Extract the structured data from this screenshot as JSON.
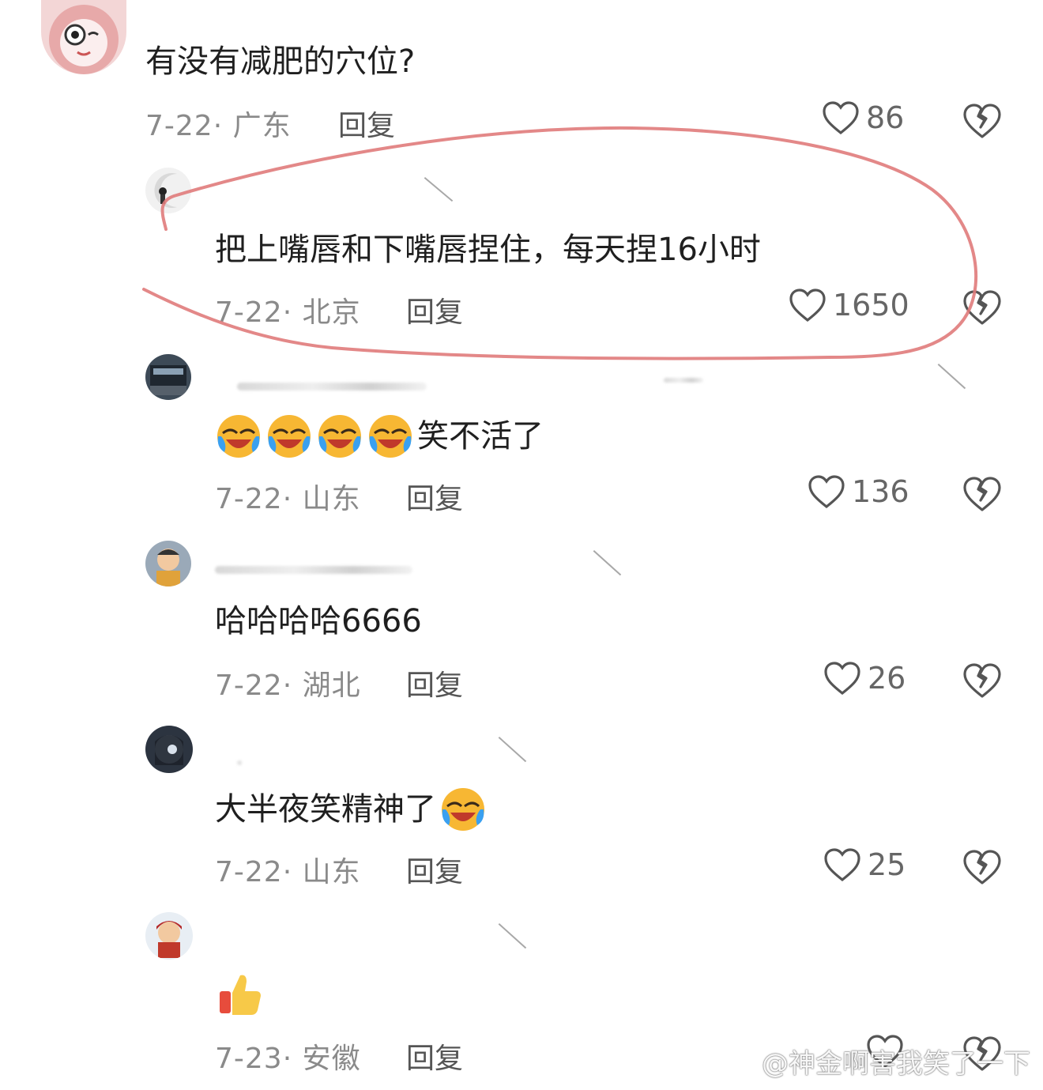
{
  "comments": [
    {
      "text": "有没有减肥的穴位?",
      "meta": "7-22· 广东",
      "reply": "回复",
      "likes": "86",
      "emoji_count": 0
    },
    {
      "text": "把上嘴唇和下嘴唇捏住，每天捏16小时",
      "meta": "7-22· 北京",
      "reply": "回复",
      "likes": "1650",
      "emoji_count": 0
    },
    {
      "text": "笑不活了",
      "meta": "7-22· 山东",
      "reply": "回复",
      "likes": "136",
      "emoji_count": 4
    },
    {
      "text": "哈哈哈哈6666",
      "meta": "7-22· 湖北",
      "reply": "回复",
      "likes": "26",
      "emoji_count": 0
    },
    {
      "text": "大半夜笑精神了",
      "meta": "7-22· 山东",
      "reply": "回复",
      "likes": "25",
      "emoji_count": 1
    },
    {
      "text": "",
      "meta": "7-23· 安徽",
      "reply": "回复",
      "likes": "",
      "emoji_count": 0
    }
  ],
  "watermark": "@神金啊害我笑了一下",
  "icons": {
    "like": "heart-outline-icon",
    "dislike": "broken-heart-icon",
    "laugh": "laughing-crying-emoji",
    "thumbs_up": "thumbs-up-emoji",
    "weibo": "weibo-logo-icon"
  },
  "colors": {
    "annotation": "#e07b7b",
    "meta": "#8a8a8a",
    "text": "#1f1f1f"
  }
}
